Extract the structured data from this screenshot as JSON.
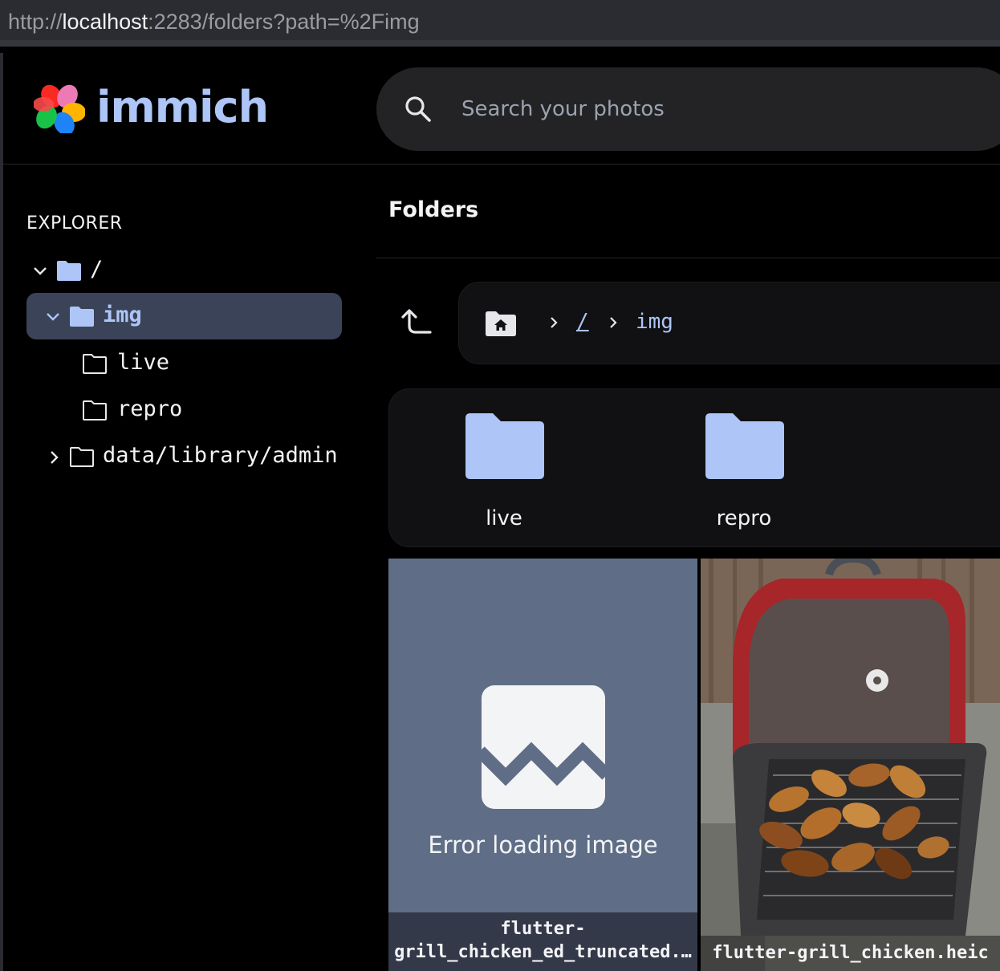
{
  "browser": {
    "url_prefix": "http://",
    "url_host": "localhost",
    "url_rest": ":2283/folders?path=%2Fimg"
  },
  "header": {
    "brand": "immich",
    "search_placeholder": "Search your photos"
  },
  "sidebar": {
    "title": "EXPLORER",
    "tree": [
      {
        "label": "/",
        "expanded": true
      },
      {
        "label": "img",
        "expanded": true,
        "active": true
      },
      {
        "label": "live"
      },
      {
        "label": "repro"
      },
      {
        "label": "data/library/admin",
        "expanded": false
      }
    ]
  },
  "main": {
    "title": "Folders",
    "breadcrumbs": [
      "/",
      "img"
    ],
    "folders": [
      {
        "name": "live"
      },
      {
        "name": "repro"
      }
    ],
    "assets": [
      {
        "error": "Error loading image",
        "filename": "flutter-grill_chicken_ed_truncated.…",
        "filename_line1": "flutter-",
        "filename_line2": "grill_chicken_ed_truncated.…"
      },
      {
        "filename": "flutter-grill_chicken.heic"
      }
    ]
  },
  "colors": {
    "accent": "#adc5f7",
    "active_row": "#3a4358",
    "error_tile": "#5f6e86"
  }
}
